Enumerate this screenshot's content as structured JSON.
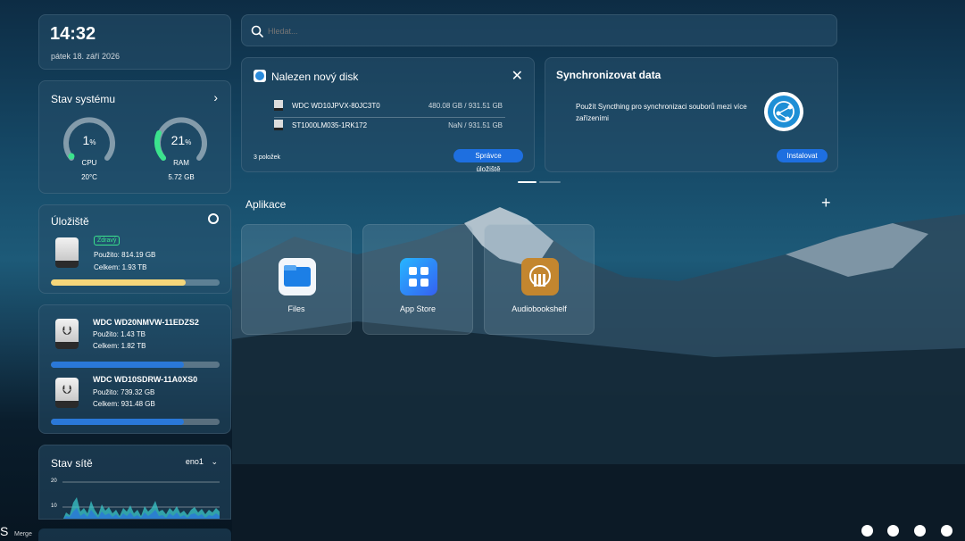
{
  "clock": {
    "time": "14:32",
    "date": "pátek 18. září 2026"
  },
  "system": {
    "title": "Stav systému",
    "cpu": {
      "value": "1",
      "unit": "%",
      "label": "CPU",
      "sub": "20°C",
      "percent": 1
    },
    "ram": {
      "value": "21",
      "unit": "%",
      "label": "RAM",
      "sub": "5.72 GB",
      "percent": 21
    }
  },
  "storage": {
    "title": "Úložiště",
    "badge": "Zdravý",
    "used": "Použito: 814.19 GB",
    "total": "Celkem: 1.93 TB",
    "fill_percent": 80,
    "fill_color": "#f5d67a"
  },
  "usb_drives": [
    {
      "name": "WDC WD20NMVW-11EDZS2",
      "used": "Použito: 1.43 TB",
      "total": "Celkem: 1.82 TB",
      "fill_percent": 79
    },
    {
      "name": "WDC WD10SDRW-11A0XS0",
      "used": "Použito: 739.32 GB",
      "total": "Celkem: 931.48 GB",
      "fill_percent": 79
    }
  ],
  "network": {
    "title": "Stav sítě",
    "interface": "eno1",
    "y_ticks": [
      "20",
      "10"
    ],
    "series_colors": [
      "#3ac7c9",
      "#2a78d8"
    ]
  },
  "search": {
    "placeholder": "Hledat..."
  },
  "new_disk": {
    "title": "Nalezen nový disk",
    "disks": [
      {
        "name": "WDC WD10JPVX-80JC3T0",
        "size": "480.08 GB / 931.51 GB"
      },
      {
        "name": "ST1000LM035-1RK172",
        "size": "NaN / 931.51 GB"
      }
    ],
    "count": "3 položek",
    "button": "Správce úložiště"
  },
  "sync": {
    "title": "Synchronizovat data",
    "text": "Použít Syncthing pro synchronizaci souborů mezi více zařízeními",
    "button": "Instalovat"
  },
  "apps": {
    "title": "Aplikace",
    "items": [
      {
        "label": "Files",
        "icon": "files-icon"
      },
      {
        "label": "App Store",
        "icon": "app-store-icon"
      },
      {
        "label": "Audiobookshelf",
        "icon": "audiobookshelf-icon"
      }
    ]
  },
  "footer": {
    "brand": "S",
    "merge_label": "Merge"
  },
  "colors": {
    "accent": "#1e6fe0",
    "gauge_green": "#3be38d",
    "bar_blue": "#2a78d8"
  }
}
